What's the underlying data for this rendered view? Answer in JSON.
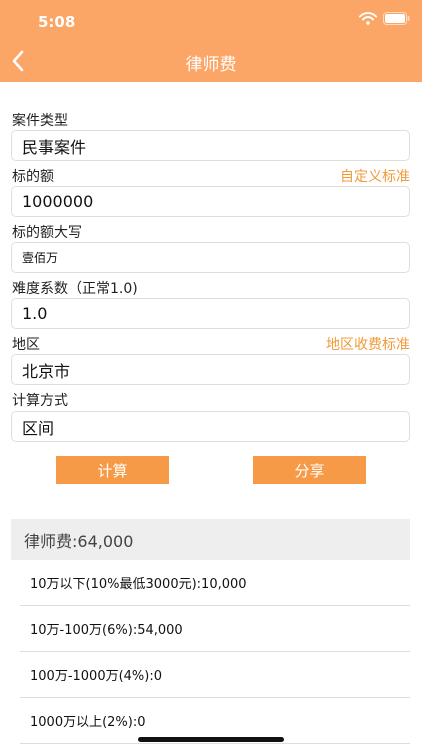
{
  "status": {
    "time": "5:08"
  },
  "nav": {
    "title": "律师费"
  },
  "form": {
    "case_type_label": "案件类型",
    "case_type_value": "民事案件",
    "amount_label": "标的额",
    "amount_link": "自定义标准",
    "amount_value": "1000000",
    "amount_caps_label": "标的额大写",
    "amount_caps_value": "壹佰万",
    "difficulty_label": "难度系数（正常1.0)",
    "difficulty_value": "1.0",
    "region_label": "地区",
    "region_link": "地区收费标准",
    "region_value": "北京市",
    "method_label": "计算方式",
    "method_value": "区间"
  },
  "buttons": {
    "calculate": "计算",
    "share": "分享"
  },
  "result": {
    "total": "律师费:64,000",
    "rows": [
      "10万以下(10%最低3000元):10,000",
      "10万-100万(6%):54,000",
      "100万-1000万(4%):0",
      "1000万以上(2%):0"
    ]
  },
  "colors": {
    "accent": "#fba566",
    "button": "#f79a48",
    "link": "#f39a3a"
  }
}
